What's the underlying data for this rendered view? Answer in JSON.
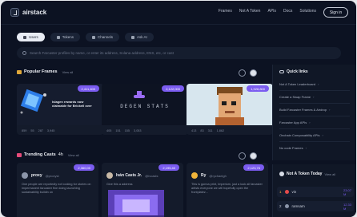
{
  "nav": {
    "brand": "airstack",
    "links": [
      "Frames",
      "Not A Token",
      "APIs",
      "Docs",
      "Solutions"
    ],
    "signin": "Sign in"
  },
  "tabs": [
    {
      "label": "Users",
      "active": true
    },
    {
      "label": "Tokens",
      "active": false
    },
    {
      "label": "Channels",
      "active": false
    },
    {
      "label": "Ask AI",
      "active": false
    }
  ],
  "search": {
    "placeholder": "Search Farcaster profiles by name, or enter its address, Solana address, ENS, etc, or cast"
  },
  "frames_section": {
    "title": "Popular Frames",
    "link": "View all"
  },
  "frames": [
    {
      "badge": "2,411,400",
      "overlay_text": "Islagen rewards now claimable for Brickell over",
      "stats": [
        "859",
        "55",
        "287",
        "3,945"
      ]
    },
    {
      "badge": "2,122,000",
      "overlay_text": "DEGEN STATS",
      "stats": [
        "405",
        "151",
        "155",
        "3,053"
      ]
    },
    {
      "badge": "1,928,800",
      "overlay_text": "",
      "stats": [
        "413",
        "83",
        "311",
        "1,862"
      ]
    }
  ],
  "casts_section": {
    "title": "Trending Casts",
    "tag": "4h",
    "link": "View all"
  },
  "casts": [
    {
      "badge": "2,360,00",
      "name": "proxy",
      "handle": "@proxyst",
      "text": "One people are reportedly not looking for stories on impermanent farcaster fine doing launching sustainability buildin on"
    },
    {
      "badge": "2,195,40",
      "name": "Iván Casts Jr.",
      "handle": "@ivcasts",
      "text": "Give this a address"
    },
    {
      "badge": "2,123,76",
      "name": "Ry",
      "handle": "@rychaeigh",
      "text": "This is gonna print, Imperium, just a look all farcaster artists everyone we will hopefully open the frontplatez..."
    }
  ],
  "quick_links": {
    "title": "Quick links",
    "items": [
      "Not A Token Leaderboard",
      "Create a Swap Frame",
      "Build Farcaster Frames & Airdrop",
      "Farcaster App APIs",
      "Onchain Composability APIs",
      "No code Frames"
    ]
  },
  "leaderboard": {
    "title": "Not A Token Today",
    "link": "View all",
    "rows": [
      {
        "rank": "1",
        "name": "vin",
        "value": "23.07 M"
      },
      {
        "rank": "2",
        "name": "ramsam",
        "value": "12.33 M"
      }
    ]
  },
  "colors": {
    "accent": "#7b5cf0",
    "background": "#0c1222",
    "card": "#141b2b"
  }
}
